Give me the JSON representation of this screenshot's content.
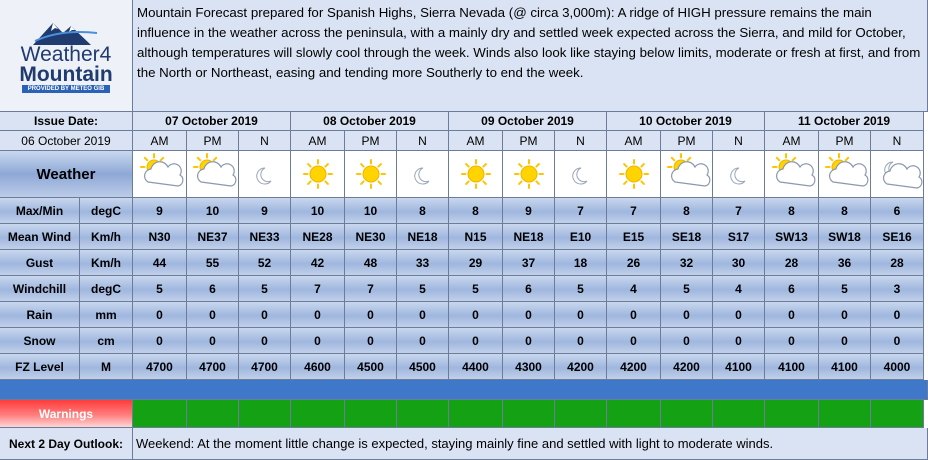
{
  "logo": {
    "line1": "Weather4",
    "line2": "Mountain",
    "tagline": "PROVIDED BY METEO GIB"
  },
  "forecast_text": "Mountain Forecast prepared for Spanish Highs, Sierra Nevada (@ circa 3,000m):  A ridge of HIGH pressure remains the main influence in the weather across the peninsula, with a mainly dry and settled week expected across the Sierra, and mild for October, although temperatures will slowly cool through the week. Winds also look like staying below limits, moderate or fresh at first, and from the North or Northeast, easing and tending more Southerly to end the week.",
  "issue": {
    "label": "Issue Date:",
    "date": "06 October 2019"
  },
  "days": [
    "07 October 2019",
    "08 October 2019",
    "09 October 2019",
    "10 October 2019",
    "11 October 2019"
  ],
  "periods": [
    "AM",
    "PM",
    "N",
    "AM",
    "PM",
    "N",
    "AM",
    "PM",
    "N",
    "AM",
    "PM",
    "N",
    "AM",
    "PM",
    "N"
  ],
  "weather_label": "Weather",
  "weather_icons": [
    "sun-cloud-icon",
    "sun-cloud-icon",
    "moon-icon",
    "sun-icon",
    "sun-icon",
    "moon-icon",
    "sun-icon",
    "sun-icon",
    "moon-icon",
    "sun-icon",
    "sun-cloud-icon",
    "moon-icon",
    "sun-cloud-icon",
    "sun-cloud-icon",
    "moon-cloud-icon"
  ],
  "rows": [
    {
      "label": "Max/Min",
      "unit": "degC",
      "values": [
        "9",
        "10",
        "9",
        "10",
        "10",
        "8",
        "8",
        "9",
        "7",
        "7",
        "8",
        "7",
        "8",
        "8",
        "6"
      ]
    },
    {
      "label": "Mean Wind",
      "unit": "Km/h",
      "values": [
        "N30",
        "NE37",
        "NE33",
        "NE28",
        "NE30",
        "NE18",
        "N15",
        "NE18",
        "E10",
        "E15",
        "SE18",
        "S17",
        "SW13",
        "SW18",
        "SE16"
      ]
    },
    {
      "label": "Gust",
      "unit": "Km/h",
      "values": [
        "44",
        "55",
        "52",
        "42",
        "48",
        "33",
        "29",
        "37",
        "18",
        "26",
        "32",
        "30",
        "28",
        "36",
        "28"
      ]
    },
    {
      "label": "Windchill",
      "unit": "degC",
      "values": [
        "5",
        "6",
        "5",
        "7",
        "7",
        "5",
        "5",
        "6",
        "5",
        "4",
        "5",
        "4",
        "6",
        "5",
        "3"
      ]
    },
    {
      "label": "Rain",
      "unit": "mm",
      "values": [
        "0",
        "0",
        "0",
        "0",
        "0",
        "0",
        "0",
        "0",
        "0",
        "0",
        "0",
        "0",
        "0",
        "0",
        "0"
      ]
    },
    {
      "label": "Snow",
      "unit": "cm",
      "values": [
        "0",
        "0",
        "0",
        "0",
        "0",
        "0",
        "0",
        "0",
        "0",
        "0",
        "0",
        "0",
        "0",
        "0",
        "0"
      ]
    },
    {
      "label": "FZ Level",
      "unit": "M",
      "values": [
        "4700",
        "4700",
        "4700",
        "4600",
        "4500",
        "4500",
        "4400",
        "4300",
        "4200",
        "4200",
        "4200",
        "4100",
        "4100",
        "4100",
        "4000"
      ]
    }
  ],
  "warnings_label": "Warnings",
  "outlook": {
    "label": "Next 2 Day Outlook:",
    "text": "Weekend: At the moment little change is expected, staying mainly fine and settled with light to moderate winds."
  },
  "colors": {
    "header_bg": "#dae3f3",
    "row_gradient": "#9fb6de",
    "band_blue": "#3f78c9",
    "warning_green": "#14a114",
    "warning_red": "#ff3b3b"
  }
}
